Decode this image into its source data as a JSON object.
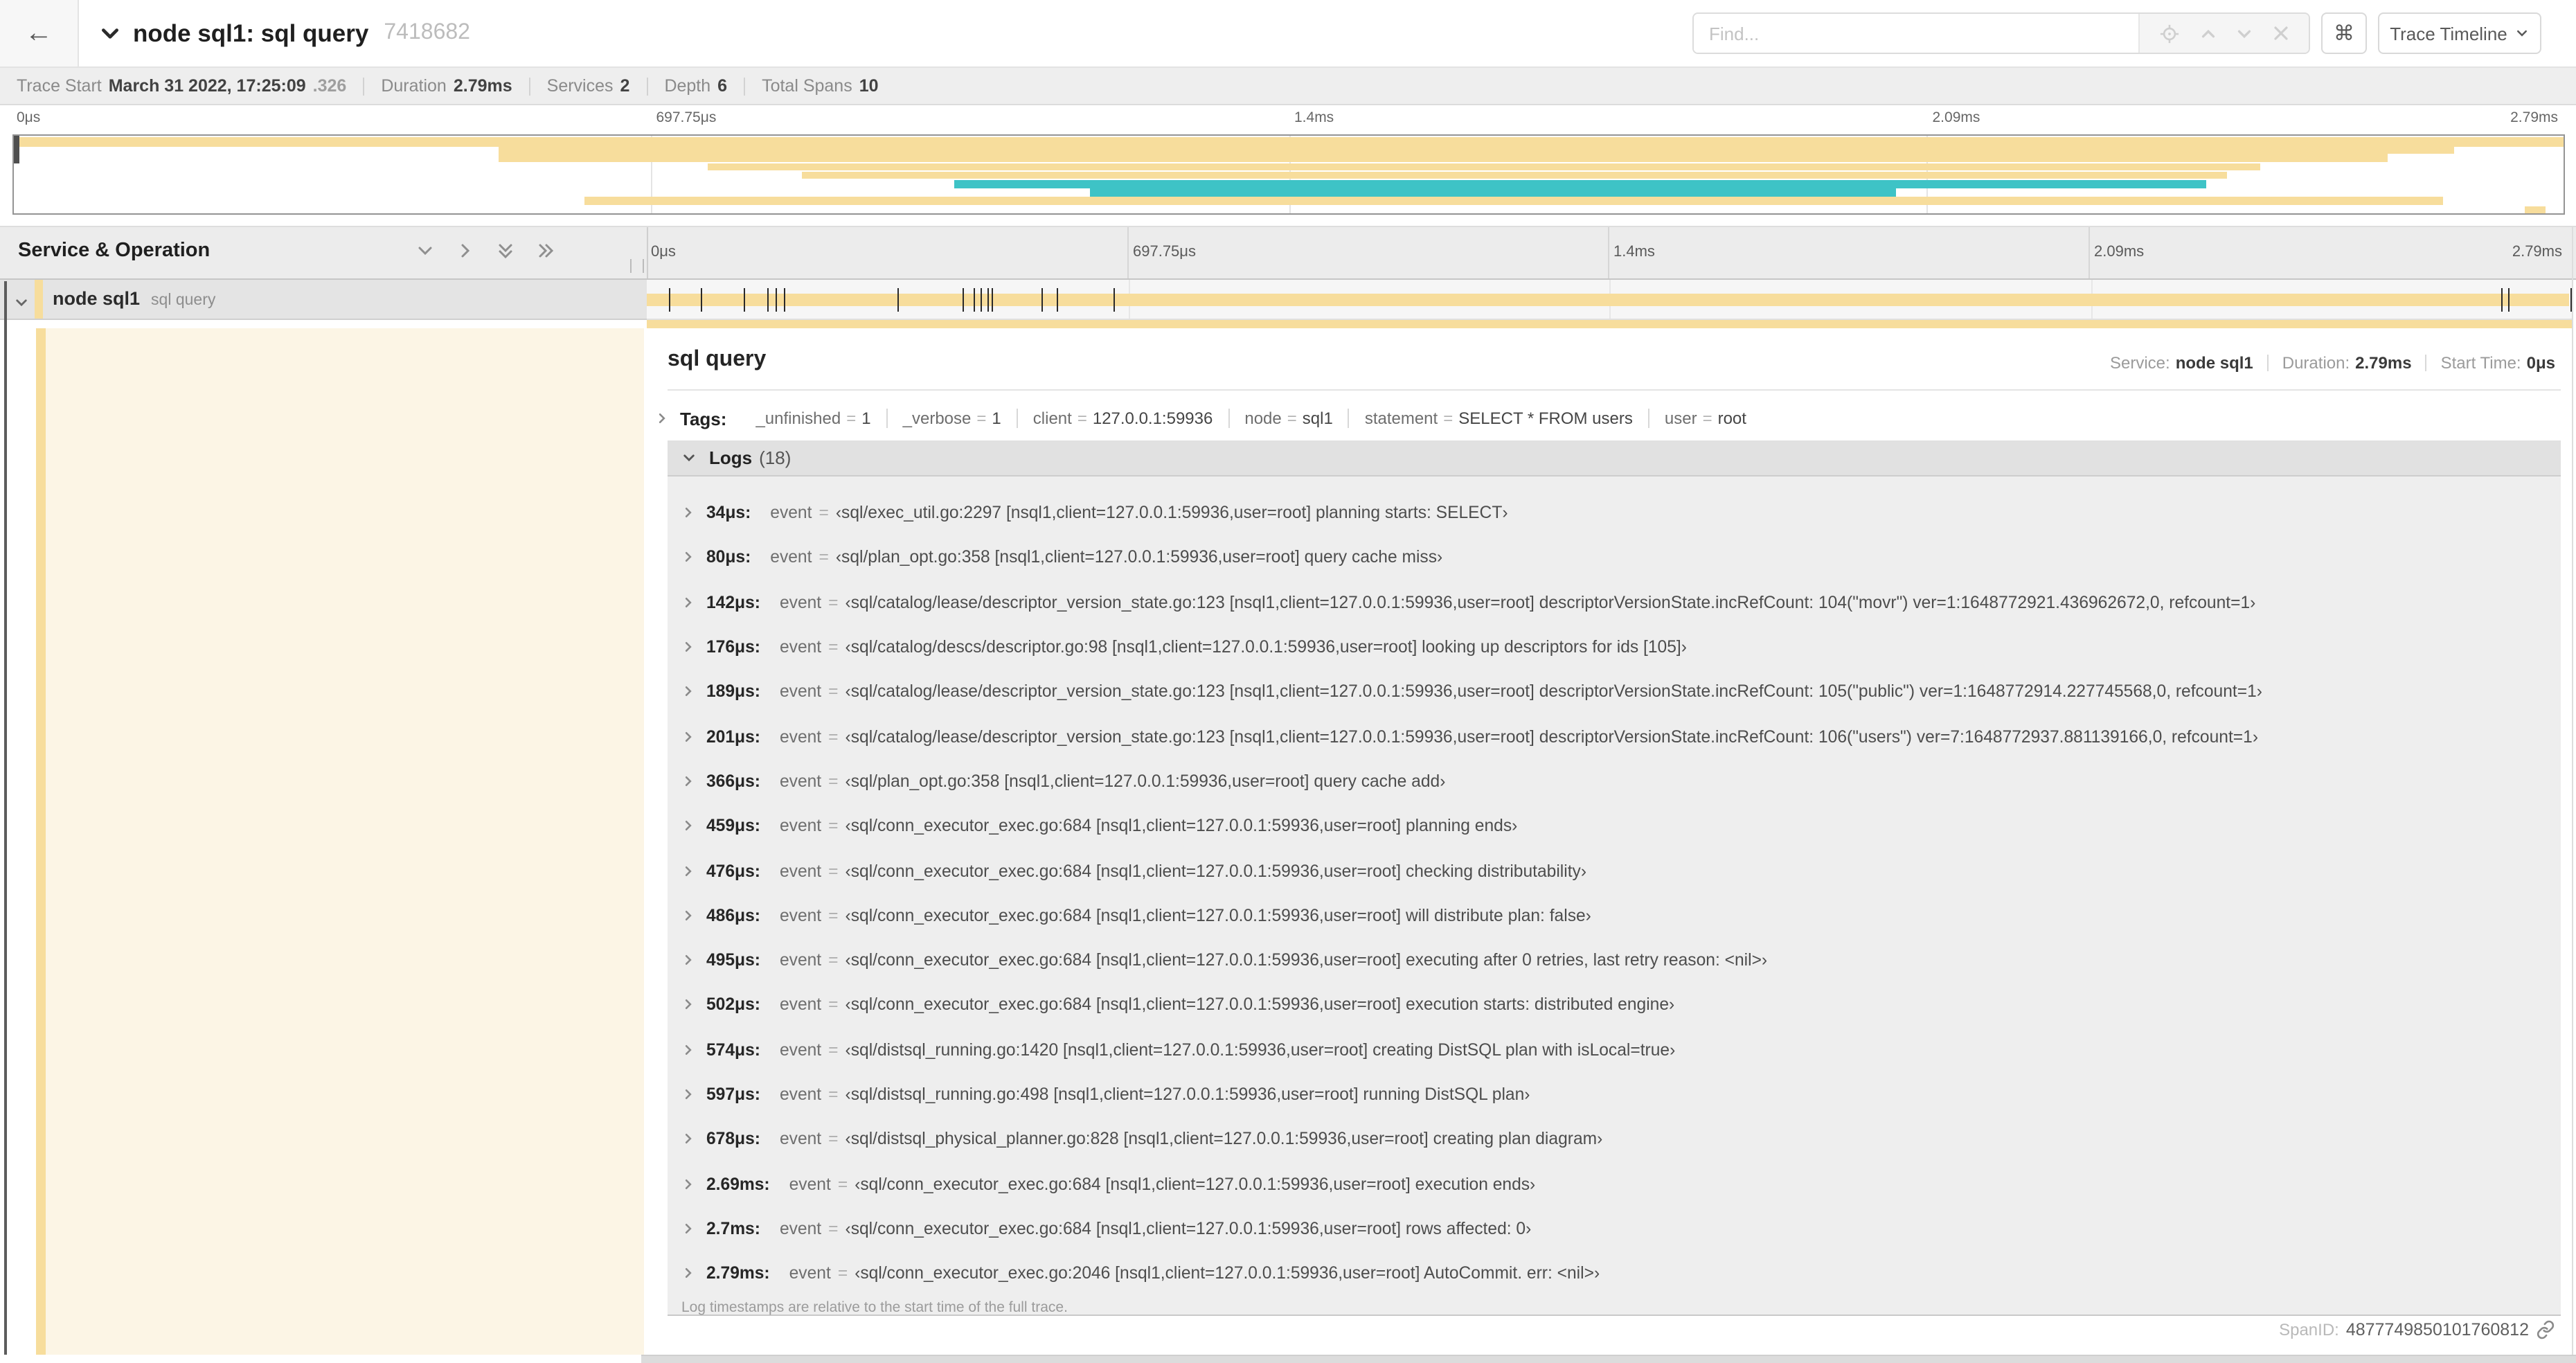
{
  "colors": {
    "tan": "#F7DD9C",
    "teal": "#3EC3C6",
    "cream": "#FCF5E5",
    "marker": "#2a2a2a"
  },
  "topbar": {
    "back_icon": "←",
    "title": "node sql1: sql query",
    "trace_id": "7418682",
    "find_placeholder": "Find...",
    "shortcut_label": "⌘",
    "view_dropdown_label": "Trace Timeline"
  },
  "metadata": {
    "items": [
      {
        "label": "Trace Start",
        "value": "March 31 2022, 17:25:09",
        "suffix": ".326"
      },
      {
        "label": "Duration",
        "value": "2.79ms"
      },
      {
        "label": "Services",
        "value": "2"
      },
      {
        "label": "Depth",
        "value": "6"
      },
      {
        "label": "Total Spans",
        "value": "10"
      }
    ]
  },
  "timeline": {
    "ticks": [
      {
        "label": "0μs",
        "pct": 0
      },
      {
        "label": "697.75μs",
        "pct": 25
      },
      {
        "label": "1.4ms",
        "pct": 50
      },
      {
        "label": "2.09ms",
        "pct": 75
      },
      {
        "label": "2.79ms",
        "pct": 100
      }
    ],
    "duration_us": 2790
  },
  "minimap": {
    "bars": [
      {
        "row": 0,
        "start_pct": 0,
        "end_pct": 100,
        "color": "tan"
      },
      {
        "row": 1,
        "start_pct": 19.0,
        "end_pct": 95.7,
        "color": "tan"
      },
      {
        "row": 2,
        "start_pct": 19.0,
        "end_pct": 93.1,
        "color": "tan"
      },
      {
        "row": 3,
        "start_pct": 27.2,
        "end_pct": 88.1,
        "color": "tan"
      },
      {
        "row": 4,
        "start_pct": 30.9,
        "end_pct": 86.8,
        "color": "tan"
      },
      {
        "row": 5,
        "start_pct": 36.9,
        "end_pct": 86.0,
        "color": "teal"
      },
      {
        "row": 6,
        "start_pct": 42.2,
        "end_pct": 73.8,
        "color": "teal"
      },
      {
        "row": 7,
        "start_pct": 22.4,
        "end_pct": 95.3,
        "color": "tan"
      },
      {
        "row": 8,
        "start_pct": 98.5,
        "end_pct": 99.3,
        "color": "tan"
      }
    ]
  },
  "tree_header": {
    "title": "Service & Operation"
  },
  "span_row": {
    "service": "node sql1",
    "operation": "sql query",
    "marker_times_us": [
      34,
      80,
      142,
      176,
      189,
      201,
      366,
      459,
      476,
      486,
      495,
      502,
      574,
      597,
      678,
      2690,
      2700,
      2790
    ]
  },
  "detail": {
    "title": "sql query",
    "meta": [
      {
        "label": "Service:",
        "value": "node sql1"
      },
      {
        "label": "Duration:",
        "value": "2.79ms"
      },
      {
        "label": "Start Time:",
        "value": "0μs"
      }
    ],
    "tags_label": "Tags:",
    "tags": [
      {
        "key": "_unfinished",
        "value": "1"
      },
      {
        "key": "_verbose",
        "value": "1"
      },
      {
        "key": "client",
        "value": "127.0.0.1:59936"
      },
      {
        "key": "node",
        "value": "sql1"
      },
      {
        "key": "statement",
        "value": "SELECT * FROM users"
      },
      {
        "key": "user",
        "value": "root"
      }
    ],
    "logs_title": "Logs",
    "logs_count": "(18)",
    "logs_field_label": "event",
    "logs_eq": "=",
    "logs": [
      {
        "time": "34μs:",
        "value": "‹sql/exec_util.go:2297 [nsql1,client=127.0.0.1:59936,user=root] planning starts: SELECT›"
      },
      {
        "time": "80μs:",
        "value": "‹sql/plan_opt.go:358 [nsql1,client=127.0.0.1:59936,user=root] query cache miss›"
      },
      {
        "time": "142μs:",
        "value": "‹sql/catalog/lease/descriptor_version_state.go:123 [nsql1,client=127.0.0.1:59936,user=root] descriptorVersionState.incRefCount: 104(\"movr\") ver=1:1648772921.436962672,0, refcount=1›"
      },
      {
        "time": "176μs:",
        "value": "‹sql/catalog/descs/descriptor.go:98 [nsql1,client=127.0.0.1:59936,user=root] looking up descriptors for ids [105]›"
      },
      {
        "time": "189μs:",
        "value": "‹sql/catalog/lease/descriptor_version_state.go:123 [nsql1,client=127.0.0.1:59936,user=root] descriptorVersionState.incRefCount: 105(\"public\") ver=1:1648772914.227745568,0, refcount=1›"
      },
      {
        "time": "201μs:",
        "value": "‹sql/catalog/lease/descriptor_version_state.go:123 [nsql1,client=127.0.0.1:59936,user=root] descriptorVersionState.incRefCount: 106(\"users\") ver=7:1648772937.881139166,0, refcount=1›"
      },
      {
        "time": "366μs:",
        "value": "‹sql/plan_opt.go:358 [nsql1,client=127.0.0.1:59936,user=root] query cache add›"
      },
      {
        "time": "459μs:",
        "value": "‹sql/conn_executor_exec.go:684 [nsql1,client=127.0.0.1:59936,user=root] planning ends›"
      },
      {
        "time": "476μs:",
        "value": "‹sql/conn_executor_exec.go:684 [nsql1,client=127.0.0.1:59936,user=root] checking distributability›"
      },
      {
        "time": "486μs:",
        "value": "‹sql/conn_executor_exec.go:684 [nsql1,client=127.0.0.1:59936,user=root] will distribute plan: false›"
      },
      {
        "time": "495μs:",
        "value": "‹sql/conn_executor_exec.go:684 [nsql1,client=127.0.0.1:59936,user=root] executing after 0 retries, last retry reason: <nil>›"
      },
      {
        "time": "502μs:",
        "value": "‹sql/conn_executor_exec.go:684 [nsql1,client=127.0.0.1:59936,user=root] execution starts: distributed engine›"
      },
      {
        "time": "574μs:",
        "value": "‹sql/distsql_running.go:1420 [nsql1,client=127.0.0.1:59936,user=root] creating DistSQL plan with isLocal=true›"
      },
      {
        "time": "597μs:",
        "value": "‹sql/distsql_running.go:498 [nsql1,client=127.0.0.1:59936,user=root] running DistSQL plan›"
      },
      {
        "time": "678μs:",
        "value": "‹sql/distsql_physical_planner.go:828 [nsql1,client=127.0.0.1:59936,user=root] creating plan diagram›"
      },
      {
        "time": "2.69ms:",
        "value": "‹sql/conn_executor_exec.go:684 [nsql1,client=127.0.0.1:59936,user=root] execution ends›"
      },
      {
        "time": "2.7ms:",
        "value": "‹sql/conn_executor_exec.go:684 [nsql1,client=127.0.0.1:59936,user=root] rows affected: 0›"
      },
      {
        "time": "2.79ms:",
        "value": "‹sql/conn_executor_exec.go:2046 [nsql1,client=127.0.0.1:59936,user=root] AutoCommit. err: <nil>›"
      }
    ],
    "logs_note": "Log timestamps are relative to the start time of the full trace.",
    "span_id_label": "SpanID:",
    "span_id": "4877749850101760812"
  }
}
